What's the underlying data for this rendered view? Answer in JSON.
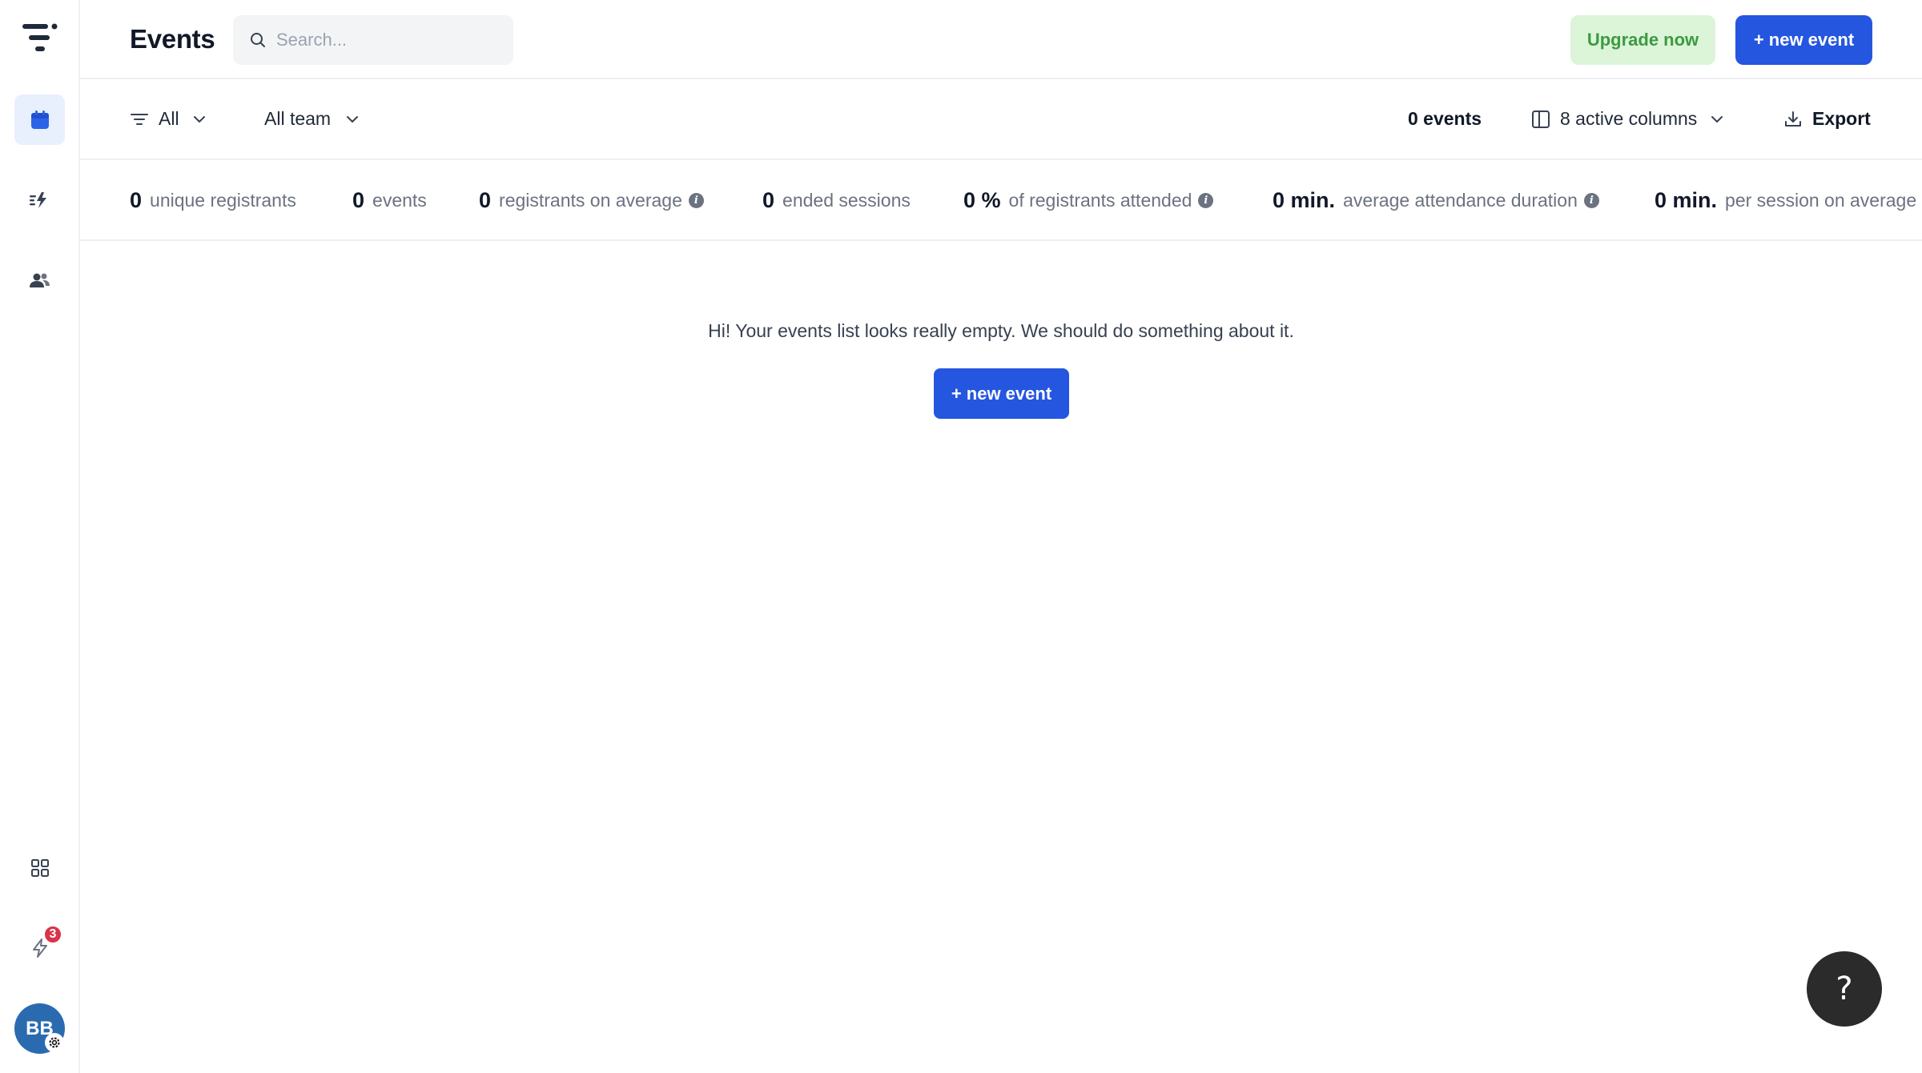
{
  "header": {
    "title": "Events",
    "search_placeholder": "Search...",
    "upgrade_label": "Upgrade now",
    "new_event_label": "+ new event"
  },
  "filters": {
    "type_filter": "All",
    "team_filter": "All team",
    "event_count": "0 events",
    "columns_label": "8 active columns",
    "export_label": "Export"
  },
  "stats": [
    {
      "value": "0",
      "label": "unique registrants",
      "info": false
    },
    {
      "value": "0",
      "label": "events",
      "info": false
    },
    {
      "value": "0",
      "label": "registrants on average",
      "info": true
    },
    {
      "value": "0",
      "label": "ended sessions",
      "info": false
    },
    {
      "value": "0 %",
      "label": "of registrants attended",
      "info": true
    },
    {
      "value": "0 min.",
      "label": "average attendance duration",
      "info": true
    },
    {
      "value": "0 min.",
      "label": "per session on average",
      "info": true
    }
  ],
  "empty_state": {
    "message": "Hi! Your events list looks really empty. We should do something about it.",
    "button_label": "+ new event"
  },
  "sidebar": {
    "notification_count": "3",
    "avatar_initials": "BB"
  },
  "help": {
    "label": "?"
  },
  "colors": {
    "primary": "#2556e0",
    "upgrade_bg": "#dcf5d9",
    "upgrade_text": "#3c9a41",
    "badge": "#d9334a",
    "avatar": "#2a6bb0"
  }
}
